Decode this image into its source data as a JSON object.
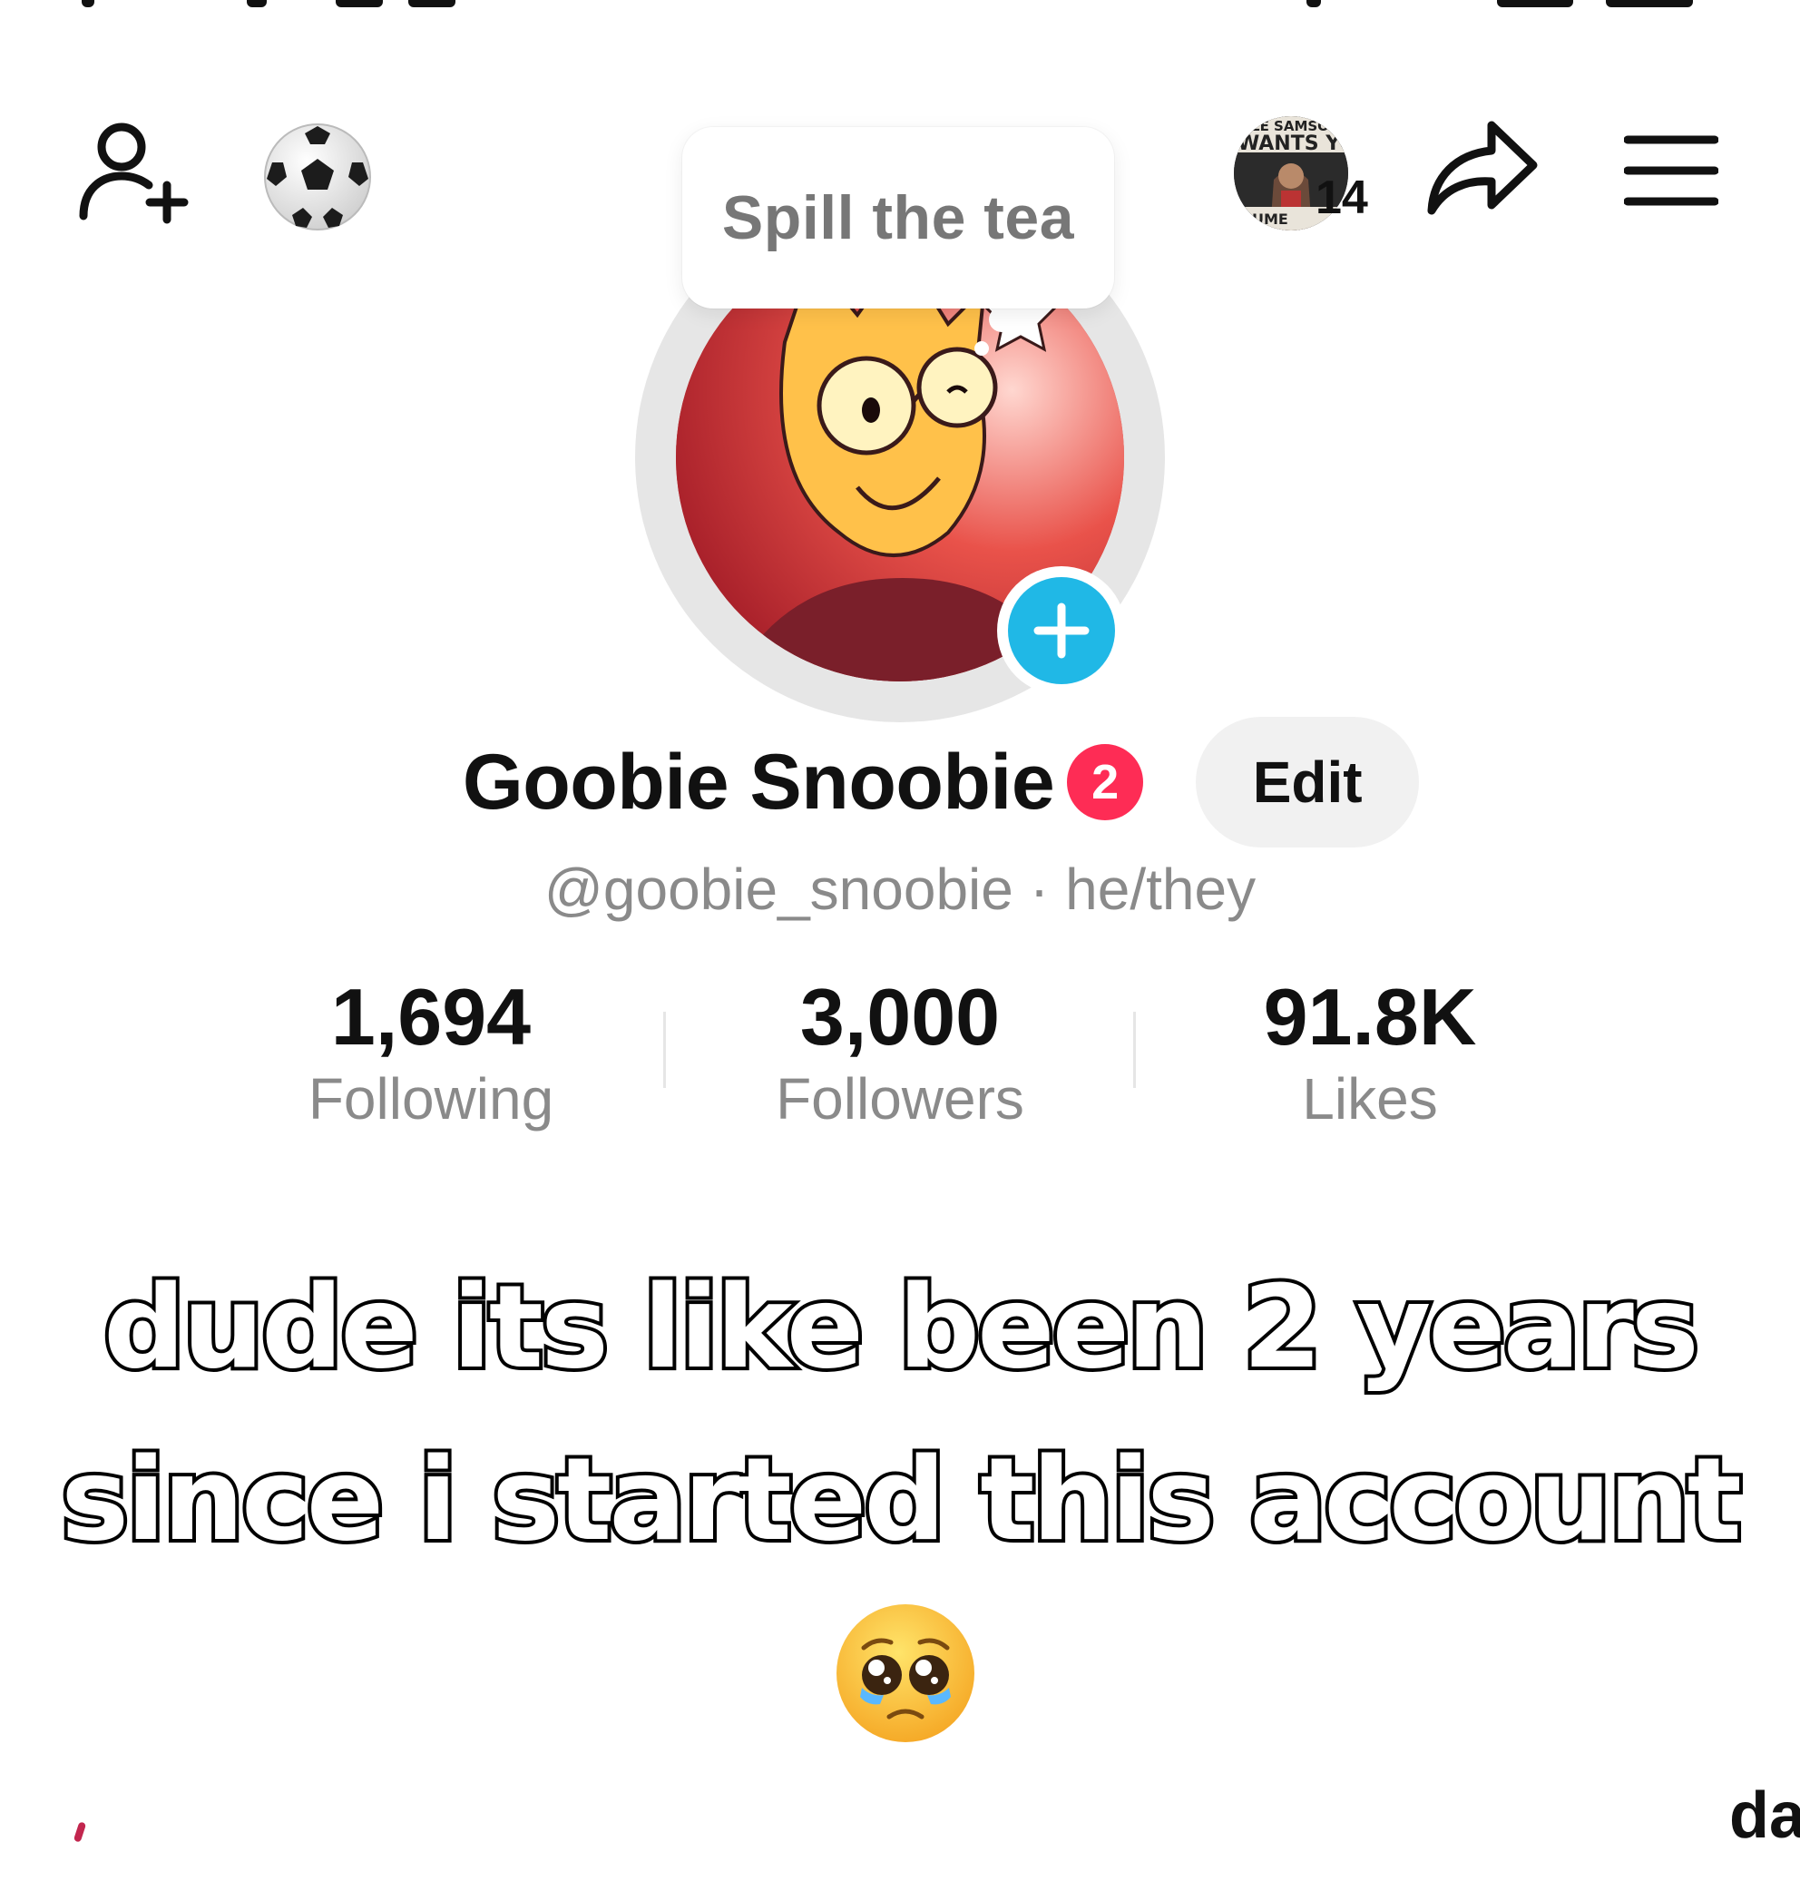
{
  "header": {
    "notification_count": "14",
    "story_thumb_lines": [
      "CLE SAMSON",
      "WANTS YOU",
      "UME"
    ]
  },
  "bubble": {
    "text": "Spill the tea"
  },
  "profile": {
    "display_name": "Goobie Snoobie",
    "name_badge_count": "2",
    "edit_label": "Edit",
    "handle": "@goobie_snoobie",
    "separator": "·",
    "pronouns": "he/they"
  },
  "stats": [
    {
      "value": "1,694",
      "label": "Following"
    },
    {
      "value": "3,000",
      "label": "Followers"
    },
    {
      "value": "91.8K",
      "label": "Likes"
    }
  ],
  "caption": {
    "line1": "dude its like been 2 years",
    "line2": "since i started this account",
    "emoji": "pleading-face-with-tears-icon"
  },
  "edge_text": "da",
  "colors": {
    "badge_red": "#fe2c55",
    "add_blue": "#20b8e6",
    "muted_text": "#8a8a8a",
    "edit_bg": "#f1f1f1"
  }
}
